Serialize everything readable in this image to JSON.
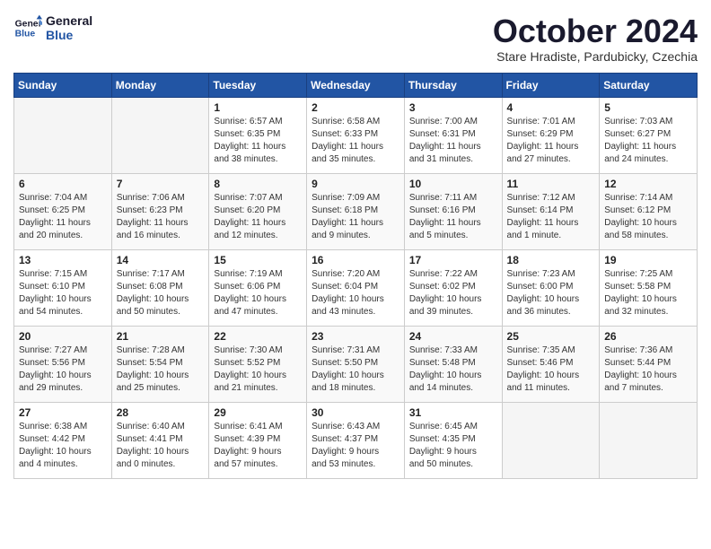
{
  "logo": {
    "line1": "General",
    "line2": "Blue"
  },
  "title": "October 2024",
  "subtitle": "Stare Hradiste, Pardubicky, Czechia",
  "days_header": [
    "Sunday",
    "Monday",
    "Tuesday",
    "Wednesday",
    "Thursday",
    "Friday",
    "Saturday"
  ],
  "weeks": [
    [
      {
        "num": "",
        "info": ""
      },
      {
        "num": "",
        "info": ""
      },
      {
        "num": "1",
        "info": "Sunrise: 6:57 AM\nSunset: 6:35 PM\nDaylight: 11 hours\nand 38 minutes."
      },
      {
        "num": "2",
        "info": "Sunrise: 6:58 AM\nSunset: 6:33 PM\nDaylight: 11 hours\nand 35 minutes."
      },
      {
        "num": "3",
        "info": "Sunrise: 7:00 AM\nSunset: 6:31 PM\nDaylight: 11 hours\nand 31 minutes."
      },
      {
        "num": "4",
        "info": "Sunrise: 7:01 AM\nSunset: 6:29 PM\nDaylight: 11 hours\nand 27 minutes."
      },
      {
        "num": "5",
        "info": "Sunrise: 7:03 AM\nSunset: 6:27 PM\nDaylight: 11 hours\nand 24 minutes."
      }
    ],
    [
      {
        "num": "6",
        "info": "Sunrise: 7:04 AM\nSunset: 6:25 PM\nDaylight: 11 hours\nand 20 minutes."
      },
      {
        "num": "7",
        "info": "Sunrise: 7:06 AM\nSunset: 6:23 PM\nDaylight: 11 hours\nand 16 minutes."
      },
      {
        "num": "8",
        "info": "Sunrise: 7:07 AM\nSunset: 6:20 PM\nDaylight: 11 hours\nand 12 minutes."
      },
      {
        "num": "9",
        "info": "Sunrise: 7:09 AM\nSunset: 6:18 PM\nDaylight: 11 hours\nand 9 minutes."
      },
      {
        "num": "10",
        "info": "Sunrise: 7:11 AM\nSunset: 6:16 PM\nDaylight: 11 hours\nand 5 minutes."
      },
      {
        "num": "11",
        "info": "Sunrise: 7:12 AM\nSunset: 6:14 PM\nDaylight: 11 hours\nand 1 minute."
      },
      {
        "num": "12",
        "info": "Sunrise: 7:14 AM\nSunset: 6:12 PM\nDaylight: 10 hours\nand 58 minutes."
      }
    ],
    [
      {
        "num": "13",
        "info": "Sunrise: 7:15 AM\nSunset: 6:10 PM\nDaylight: 10 hours\nand 54 minutes."
      },
      {
        "num": "14",
        "info": "Sunrise: 7:17 AM\nSunset: 6:08 PM\nDaylight: 10 hours\nand 50 minutes."
      },
      {
        "num": "15",
        "info": "Sunrise: 7:19 AM\nSunset: 6:06 PM\nDaylight: 10 hours\nand 47 minutes."
      },
      {
        "num": "16",
        "info": "Sunrise: 7:20 AM\nSunset: 6:04 PM\nDaylight: 10 hours\nand 43 minutes."
      },
      {
        "num": "17",
        "info": "Sunrise: 7:22 AM\nSunset: 6:02 PM\nDaylight: 10 hours\nand 39 minutes."
      },
      {
        "num": "18",
        "info": "Sunrise: 7:23 AM\nSunset: 6:00 PM\nDaylight: 10 hours\nand 36 minutes."
      },
      {
        "num": "19",
        "info": "Sunrise: 7:25 AM\nSunset: 5:58 PM\nDaylight: 10 hours\nand 32 minutes."
      }
    ],
    [
      {
        "num": "20",
        "info": "Sunrise: 7:27 AM\nSunset: 5:56 PM\nDaylight: 10 hours\nand 29 minutes."
      },
      {
        "num": "21",
        "info": "Sunrise: 7:28 AM\nSunset: 5:54 PM\nDaylight: 10 hours\nand 25 minutes."
      },
      {
        "num": "22",
        "info": "Sunrise: 7:30 AM\nSunset: 5:52 PM\nDaylight: 10 hours\nand 21 minutes."
      },
      {
        "num": "23",
        "info": "Sunrise: 7:31 AM\nSunset: 5:50 PM\nDaylight: 10 hours\nand 18 minutes."
      },
      {
        "num": "24",
        "info": "Sunrise: 7:33 AM\nSunset: 5:48 PM\nDaylight: 10 hours\nand 14 minutes."
      },
      {
        "num": "25",
        "info": "Sunrise: 7:35 AM\nSunset: 5:46 PM\nDaylight: 10 hours\nand 11 minutes."
      },
      {
        "num": "26",
        "info": "Sunrise: 7:36 AM\nSunset: 5:44 PM\nDaylight: 10 hours\nand 7 minutes."
      }
    ],
    [
      {
        "num": "27",
        "info": "Sunrise: 6:38 AM\nSunset: 4:42 PM\nDaylight: 10 hours\nand 4 minutes."
      },
      {
        "num": "28",
        "info": "Sunrise: 6:40 AM\nSunset: 4:41 PM\nDaylight: 10 hours\nand 0 minutes."
      },
      {
        "num": "29",
        "info": "Sunrise: 6:41 AM\nSunset: 4:39 PM\nDaylight: 9 hours\nand 57 minutes."
      },
      {
        "num": "30",
        "info": "Sunrise: 6:43 AM\nSunset: 4:37 PM\nDaylight: 9 hours\nand 53 minutes."
      },
      {
        "num": "31",
        "info": "Sunrise: 6:45 AM\nSunset: 4:35 PM\nDaylight: 9 hours\nand 50 minutes."
      },
      {
        "num": "",
        "info": ""
      },
      {
        "num": "",
        "info": ""
      }
    ]
  ]
}
